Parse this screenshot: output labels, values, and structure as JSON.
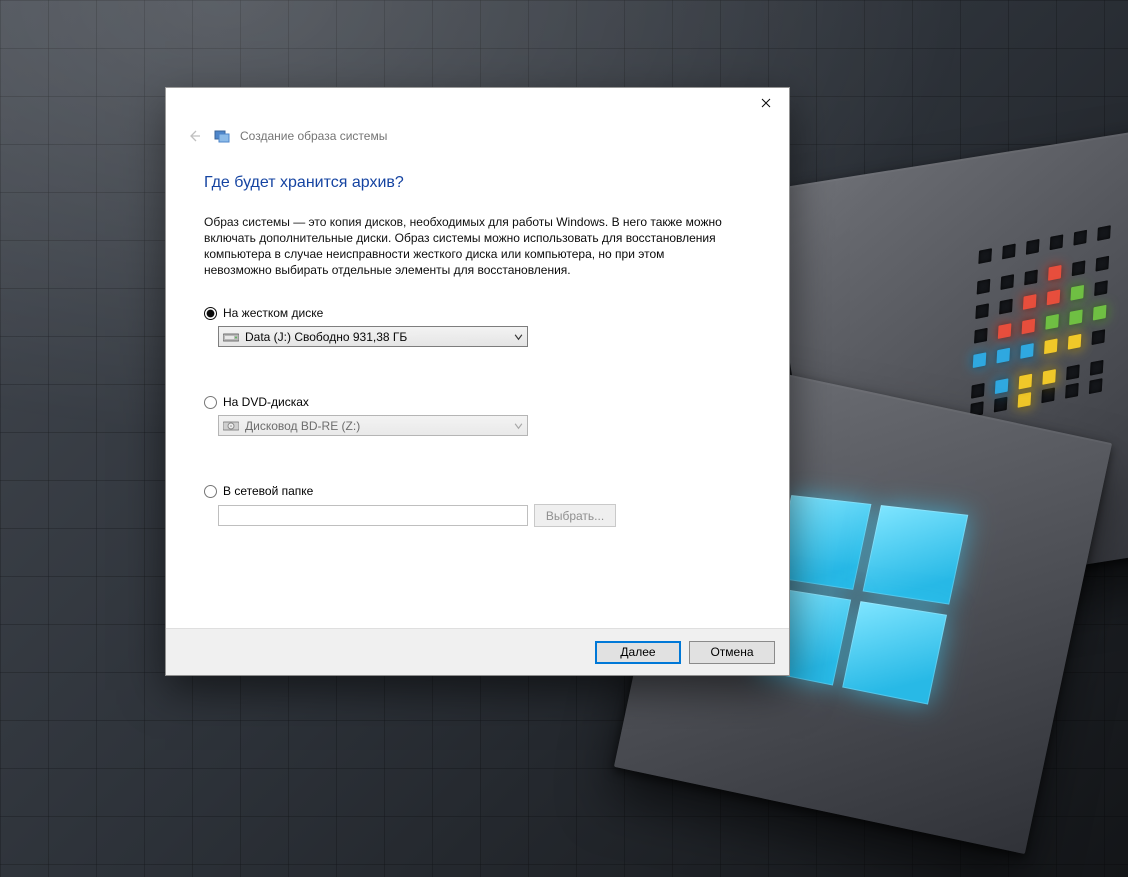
{
  "window": {
    "title": "Создание образа системы"
  },
  "page": {
    "heading": "Где будет хранится архив?",
    "description": "Образ системы — это копия дисков, необходимых для работы Windows. В него также можно включать дополнительные диски. Образ системы можно использовать для восстановления компьютера в случае неисправности жесткого диска или компьютера, но при этом невозможно выбирать отдельные элементы для восстановления."
  },
  "options": {
    "hdd": {
      "label": "На жестком диске",
      "selected": true,
      "value": "Data (J:)  Свободно 931,38 ГБ"
    },
    "dvd": {
      "label": "На DVD-дисках",
      "selected": false,
      "value": "Дисковод BD-RE (Z:)"
    },
    "network": {
      "label": "В сетевой папке",
      "selected": false,
      "path": "",
      "browse_label": "Выбрать..."
    }
  },
  "footer": {
    "next": "Далее",
    "cancel": "Отмена"
  }
}
